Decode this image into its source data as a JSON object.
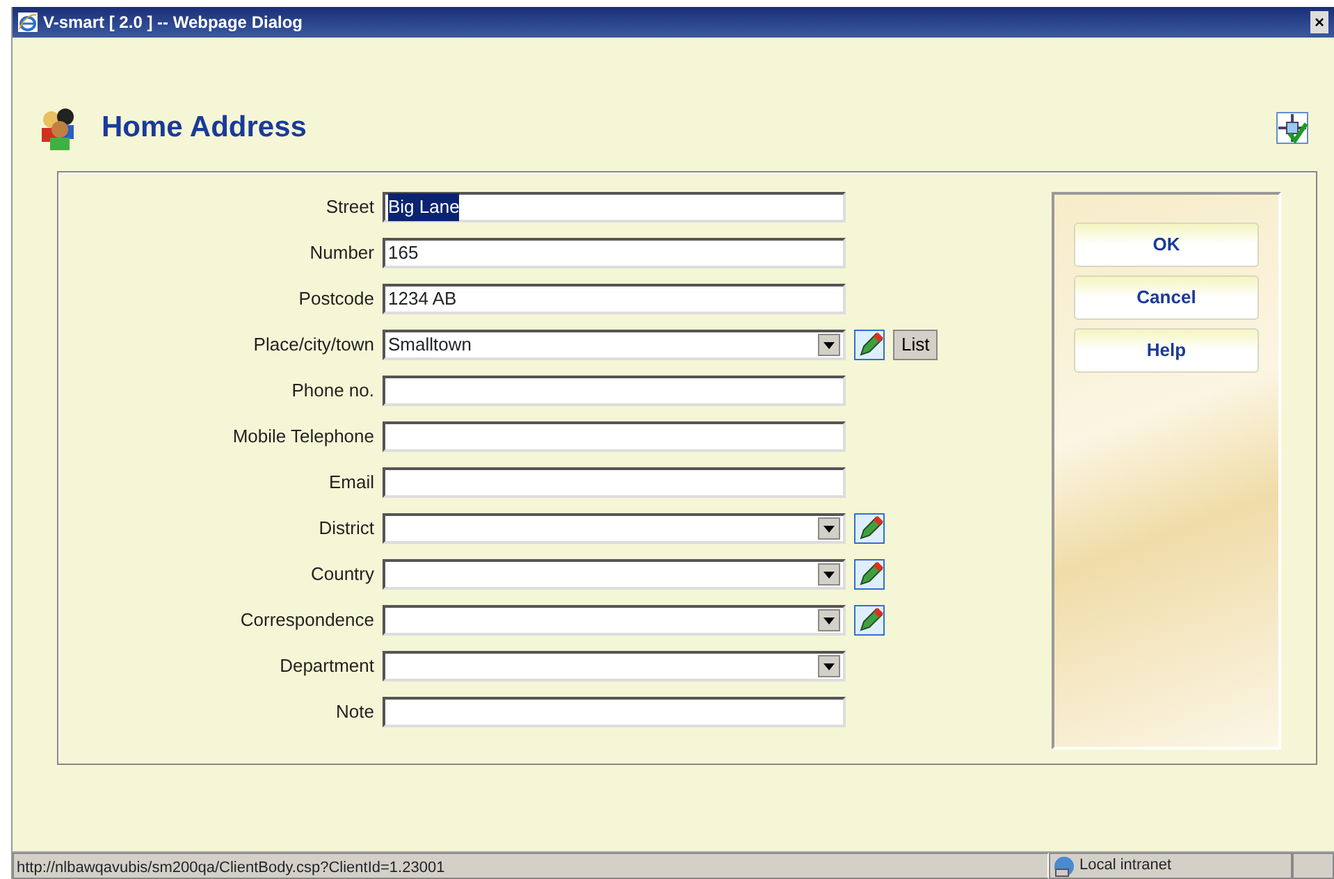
{
  "window": {
    "title": "V-smart [ 2.0 ] -- Webpage Dialog",
    "close": "×"
  },
  "heading": "Home Address",
  "fields": [
    {
      "label": "Street",
      "kind": "text",
      "value": "Big Lane",
      "value_selected": true
    },
    {
      "label": "Number",
      "kind": "text",
      "value": "165",
      "value_selected": false
    },
    {
      "label": "Postcode",
      "kind": "text",
      "value": "1234 AB",
      "value_selected": false
    },
    {
      "label": "Place/city/town",
      "kind": "select",
      "value": "Smalltown",
      "value_selected": false,
      "edit_icon": true,
      "list_button": "List"
    },
    {
      "label": "Phone no.",
      "kind": "text"
    },
    {
      "label": "Mobile Telephone",
      "kind": "text"
    },
    {
      "label": "Email",
      "kind": "text"
    },
    {
      "label": "District",
      "kind": "select",
      "edit_icon": true
    },
    {
      "label": "Country",
      "kind": "select",
      "edit_icon": true
    },
    {
      "label": "Correspondence",
      "kind": "select",
      "edit_icon": true
    },
    {
      "label": "Department",
      "kind": "select"
    },
    {
      "label": "Note",
      "kind": "text"
    }
  ],
  "buttons": [
    "OK",
    "Cancel",
    "Help"
  ],
  "status_bar": {
    "url": "http://nlbawqavubis/sm200qa/ClientBody.csp?ClientId=1.23001",
    "zone": "Local intranet"
  }
}
